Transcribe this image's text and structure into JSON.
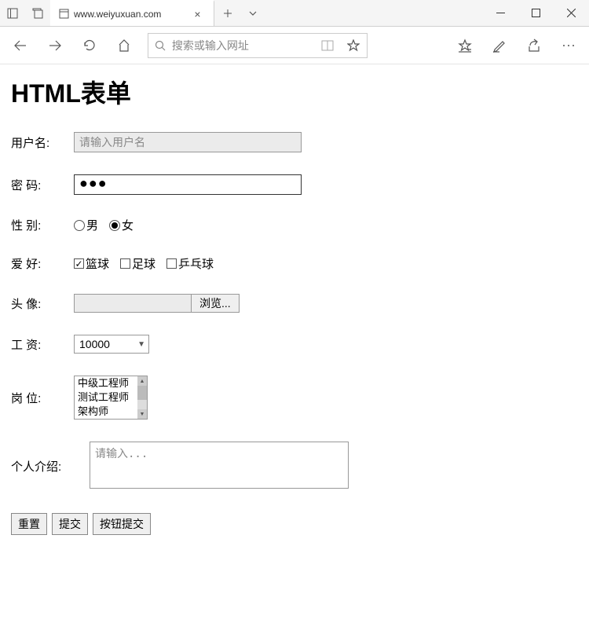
{
  "titlebar": {
    "tab_title": "www.weiyuxuan.com"
  },
  "toolbar": {
    "search_placeholder": "搜索或输入网址"
  },
  "page": {
    "heading": "HTML表单",
    "labels": {
      "username": "用户名:",
      "password": "密  码:",
      "gender": "性  别:",
      "hobby": "爱  好:",
      "avatar": "头  像:",
      "salary": "工  资:",
      "position": "岗  位:",
      "intro": "个人介绍:"
    },
    "username_placeholder": "请输入用户名",
    "password_value": "●●●",
    "gender": {
      "male": "男",
      "female": "女",
      "selected": "female"
    },
    "hobby": {
      "basketball": "篮球",
      "football": "足球",
      "pingpong": "乒乓球",
      "checked": [
        "basketball"
      ]
    },
    "file_browse": "浏览...",
    "salary_selected": "10000",
    "position_options": [
      "中级工程师",
      "测试工程师",
      "架构师"
    ],
    "intro_placeholder": "请输入...",
    "buttons": {
      "reset": "重置",
      "submit": "提交",
      "button_submit": "按钮提交"
    }
  }
}
